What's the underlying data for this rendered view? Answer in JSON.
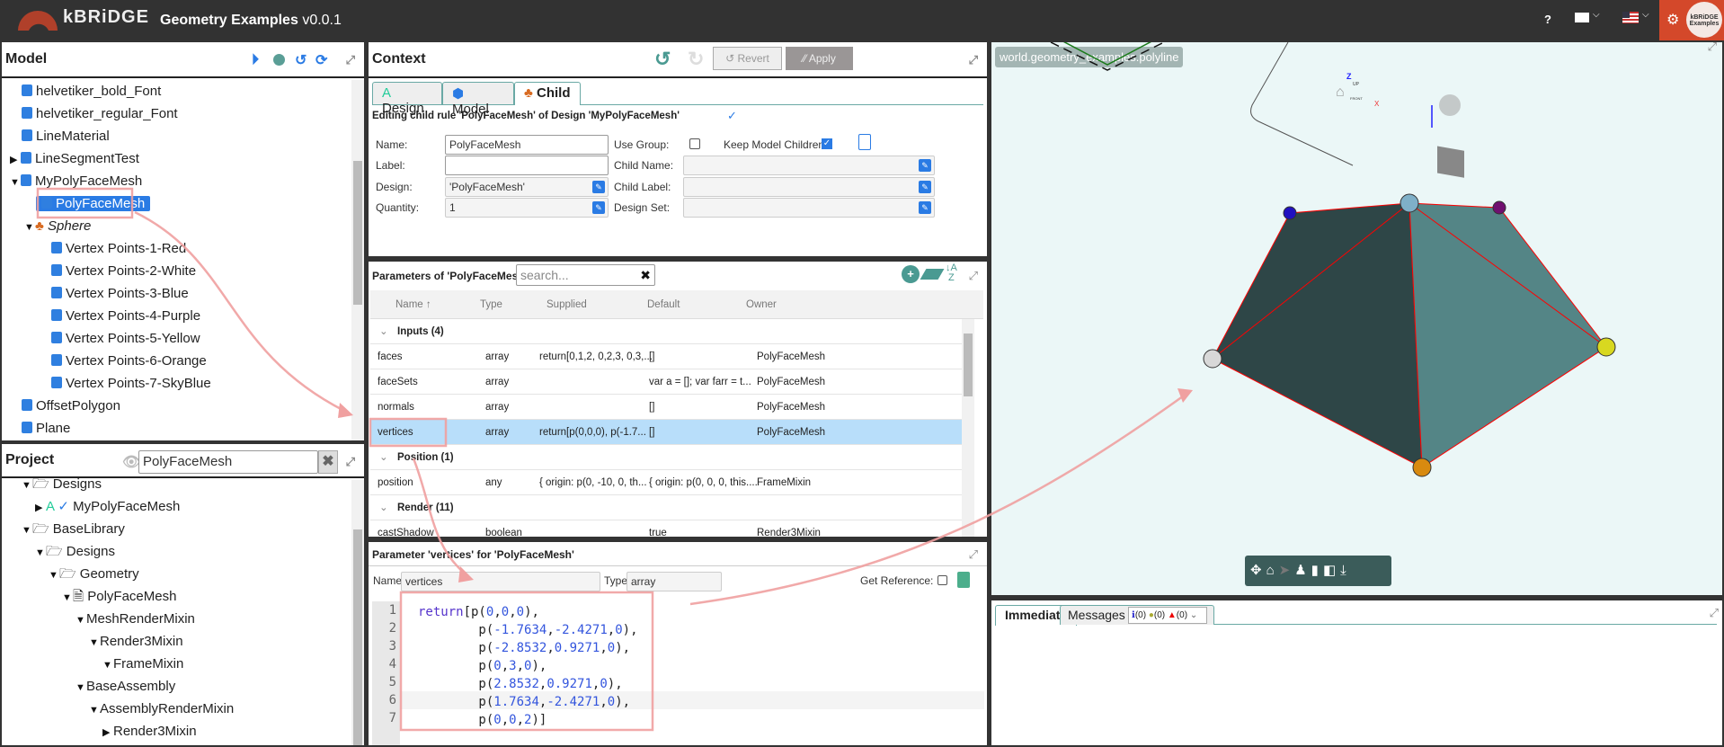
{
  "header": {
    "logo": "kBRiDGE",
    "title": "Geometry Examples",
    "version": "v0.0.1",
    "help": "?",
    "badge": "kBRiDGE Examples"
  },
  "model": {
    "title": "Model",
    "items": [
      {
        "label": "helvetiker_bold_Font",
        "level": 1,
        "caret": ""
      },
      {
        "label": "helvetiker_regular_Font",
        "level": 1,
        "caret": ""
      },
      {
        "label": "LineMaterial",
        "level": 1,
        "caret": ""
      },
      {
        "label": "LineSegmentTest",
        "level": 1,
        "caret": "right"
      },
      {
        "label": "MyPolyFaceMesh",
        "level": 1,
        "caret": "down"
      },
      {
        "label": "PolyFaceMesh",
        "level": 2,
        "caret": "",
        "selected": true
      },
      {
        "label": "Sphere",
        "level": 2,
        "caret": "down",
        "italic": true
      },
      {
        "label": "Vertex Points-1-Red",
        "level": 3
      },
      {
        "label": "Vertex Points-2-White",
        "level": 3
      },
      {
        "label": "Vertex Points-3-Blue",
        "level": 3
      },
      {
        "label": "Vertex Points-4-Purple",
        "level": 3
      },
      {
        "label": "Vertex Points-5-Yellow",
        "level": 3
      },
      {
        "label": "Vertex Points-6-Orange",
        "level": 3
      },
      {
        "label": "Vertex Points-7-SkyBlue",
        "level": 3
      },
      {
        "label": "OffsetPolygon",
        "level": 1
      },
      {
        "label": "Plane",
        "level": 1
      }
    ]
  },
  "project": {
    "title": "Project",
    "search_value": "PolyFaceMesh",
    "items": [
      {
        "label": "Designs",
        "indent": 0
      },
      {
        "label": "MyPolyFaceMesh",
        "indent": 1
      },
      {
        "label": "BaseLibrary",
        "indent": 0
      },
      {
        "label": "Designs",
        "indent": 1
      },
      {
        "label": "Geometry",
        "indent": 2
      },
      {
        "label": "PolyFaceMesh",
        "indent": 3
      },
      {
        "label": "MeshRenderMixin",
        "indent": 4
      },
      {
        "label": "Render3Mixin",
        "indent": 5
      },
      {
        "label": "FrameMixin",
        "indent": 6
      },
      {
        "label": "BaseAssembly",
        "indent": 4
      },
      {
        "label": "AssemblyRenderMixin",
        "indent": 5
      },
      {
        "label": "Render3Mixin",
        "indent": 6
      }
    ]
  },
  "context": {
    "title": "Context",
    "revert": "Revert",
    "apply": "Apply",
    "tabs": [
      "Design",
      "Model",
      "Child"
    ],
    "active_tab": "Child",
    "editing": "Editing child rule 'PolyFaceMesh' of Design 'MyPolyFaceMesh'",
    "fields": {
      "name_label": "Name:",
      "name": "PolyFaceMesh",
      "label_label": "Label:",
      "label": "",
      "design_label": "Design:",
      "design": "'PolyFaceMesh'",
      "quantity_label": "Quantity:",
      "quantity": "1",
      "use_group_label": "Use Group:",
      "use_group": false,
      "keep_label": "Keep Model Children:",
      "keep": true,
      "child_name_label": "Child Name:",
      "child_label_label": "Child Label:",
      "design_set_label": "Design Set:"
    }
  },
  "parameters": {
    "title": "Parameters of 'PolyFaceMesh'",
    "search_placeholder": "search...",
    "columns": [
      "Name ↑",
      "Type",
      "Supplied",
      "Default",
      "Owner"
    ],
    "rows": [
      {
        "group": "Inputs (4)"
      },
      {
        "name": "faces",
        "type": "array",
        "supplied": "return[0,1,2, 0,2,3, 0,3,...",
        "default": "[]",
        "owner": "PolyFaceMesh"
      },
      {
        "name": "faceSets",
        "type": "array",
        "supplied": "",
        "default": "var a = []; var farr = t...",
        "owner": "PolyFaceMesh"
      },
      {
        "name": "normals",
        "type": "array",
        "supplied": "",
        "default": "[]",
        "owner": "PolyFaceMesh"
      },
      {
        "name": "vertices",
        "type": "array",
        "supplied": "return[p(0,0,0), p(-1.7...",
        "default": "[]",
        "owner": "PolyFaceMesh",
        "selected": true
      },
      {
        "group": "Position (1)"
      },
      {
        "name": "position",
        "type": "any",
        "supplied": "{ origin: p(0, -10, 0, th...",
        "default": "{ origin: p(0, 0, 0, this....",
        "owner": "FrameMixin"
      },
      {
        "group": "Render (11)"
      },
      {
        "name": "castShadow",
        "type": "boolean",
        "supplied": "",
        "default": "true",
        "owner": "Render3Mixin"
      }
    ]
  },
  "editor": {
    "title": "Parameter 'vertices' for 'PolyFaceMesh'",
    "name_label": "Name:",
    "name": "vertices",
    "type_label": "Type:",
    "type": "array",
    "get_ref_label": "Get Reference:",
    "lines": [
      "return[p(0,0,0),",
      "        p(-1.7634,-2.4271,0),",
      "        p(-2.8532,0.9271,0),",
      "        p(0,3,0),",
      "        p(2.8532,0.9271,0),",
      "        p(1.7634,-2.4271,0),",
      "        p(0,0,2)]"
    ],
    "line_numbers": [
      "1",
      "2",
      "3",
      "4",
      "5",
      "6",
      "7"
    ]
  },
  "viewport": {
    "path": "world.geometry_examples.polyline",
    "axis_z": "Z",
    "axis_x": "X",
    "cube_up": "UP",
    "cube_front": "FRONT",
    "vertex_colors": {
      "white": "#d8d8d8",
      "blue": "#2010c0",
      "skyblue": "#7fb0c8",
      "purple": "#701070",
      "yellow": "#d8d820",
      "orange": "#d88a10"
    }
  },
  "bottom": {
    "tabs": [
      "Immediate",
      "Messages Log"
    ],
    "info": "(0)",
    "warn": "(0)",
    "error": "(0)"
  }
}
